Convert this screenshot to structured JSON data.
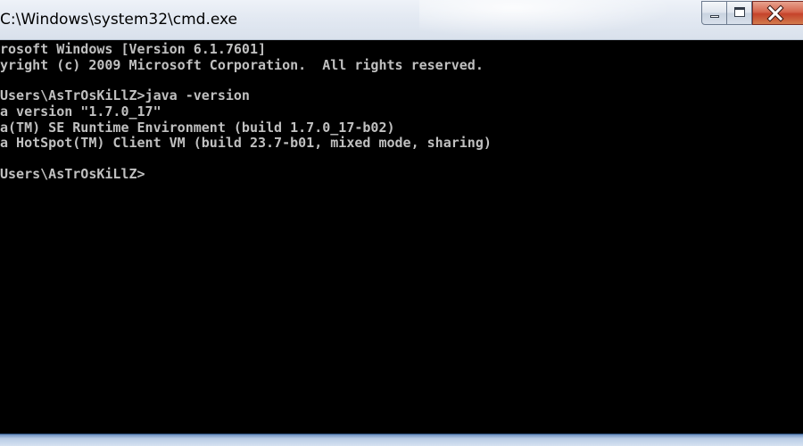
{
  "window": {
    "title": "C:\\Windows\\system32\\cmd.exe"
  },
  "caption_buttons": {
    "minimize_icon": "minimize-icon",
    "maximize_icon": "maximize-icon",
    "close_icon": "close-icon",
    "close_color": "#c5432b"
  },
  "console": {
    "background": "#000000",
    "foreground": "#c0c0c0",
    "lines": [
      "rosoft Windows [Version 6.1.7601]",
      "yright (c) 2009 Microsoft Corporation.  All rights reserved.",
      "",
      "Users\\AsTrOsKiLlZ>java -version",
      "a version \"1.7.0_17\"",
      "a(TM) SE Runtime Environment (build 1.7.0_17-b02)",
      "a HotSpot(TM) Client VM (build 23.7-b01, mixed mode, sharing)",
      "",
      "Users\\AsTrOsKiLlZ>"
    ]
  }
}
